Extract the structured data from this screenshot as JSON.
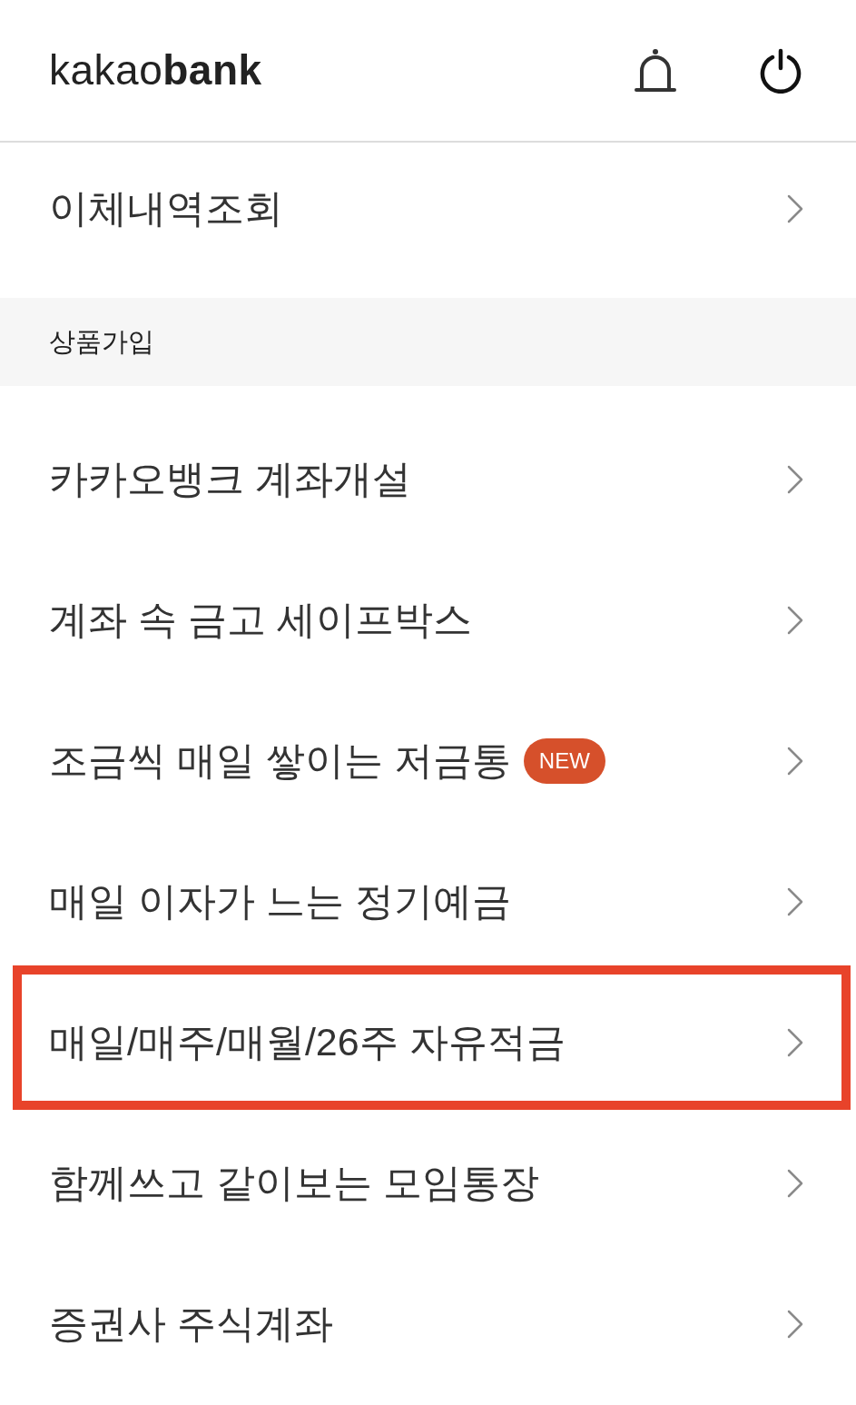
{
  "header": {
    "logo": "kakao**bank**"
  },
  "top_items": [
    {
      "label": "이체내역조회",
      "highlighted": false
    }
  ],
  "section": {
    "title": "상품가입",
    "items": [
      {
        "label": "카카오뱅크 계좌개설",
        "highlighted": false
      },
      {
        "label": "계좌 속 금고 세이프박스",
        "highlighted": false
      },
      {
        "label": "조금씩 매일 쌓이는 저금통",
        "badge": "NEW",
        "highlighted": false
      },
      {
        "label": "매일 이자가 느는 정기예금",
        "highlighted": false
      },
      {
        "label": "매일/매주/매월/26주 자유적금",
        "highlighted": true
      },
      {
        "label": "함께쓰고 같이보는 모임통장",
        "highlighted": false
      },
      {
        "label": "증권사 주식계좌",
        "highlighted": false
      }
    ]
  }
}
